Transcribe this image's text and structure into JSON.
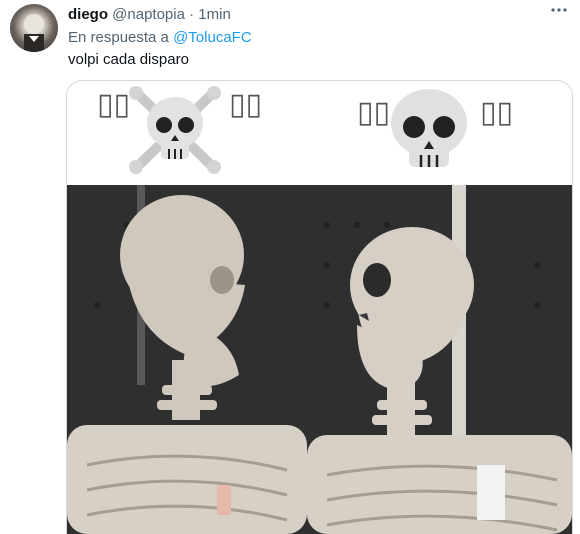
{
  "tweet": {
    "display_name": "diego",
    "handle": "@naptopia",
    "separator": "·",
    "time": "1min",
    "reply_prefix": "En respuesta a",
    "reply_to": "@TolucaFC",
    "text": "volpi cada disparo",
    "more_icon": "more-horizontal-icon"
  },
  "media": {
    "caption_left": "▯▯",
    "caption_left2": "▯▯",
    "caption_right": "▯▯",
    "caption_right2": "▯▯",
    "icons": [
      "skull-and-crossbones-icon",
      "skull-icon"
    ],
    "photo_icon": "skeletons-photo"
  },
  "colors": {
    "link": "#1d9bf0",
    "muted": "#536471",
    "border": "#cfd9de"
  }
}
